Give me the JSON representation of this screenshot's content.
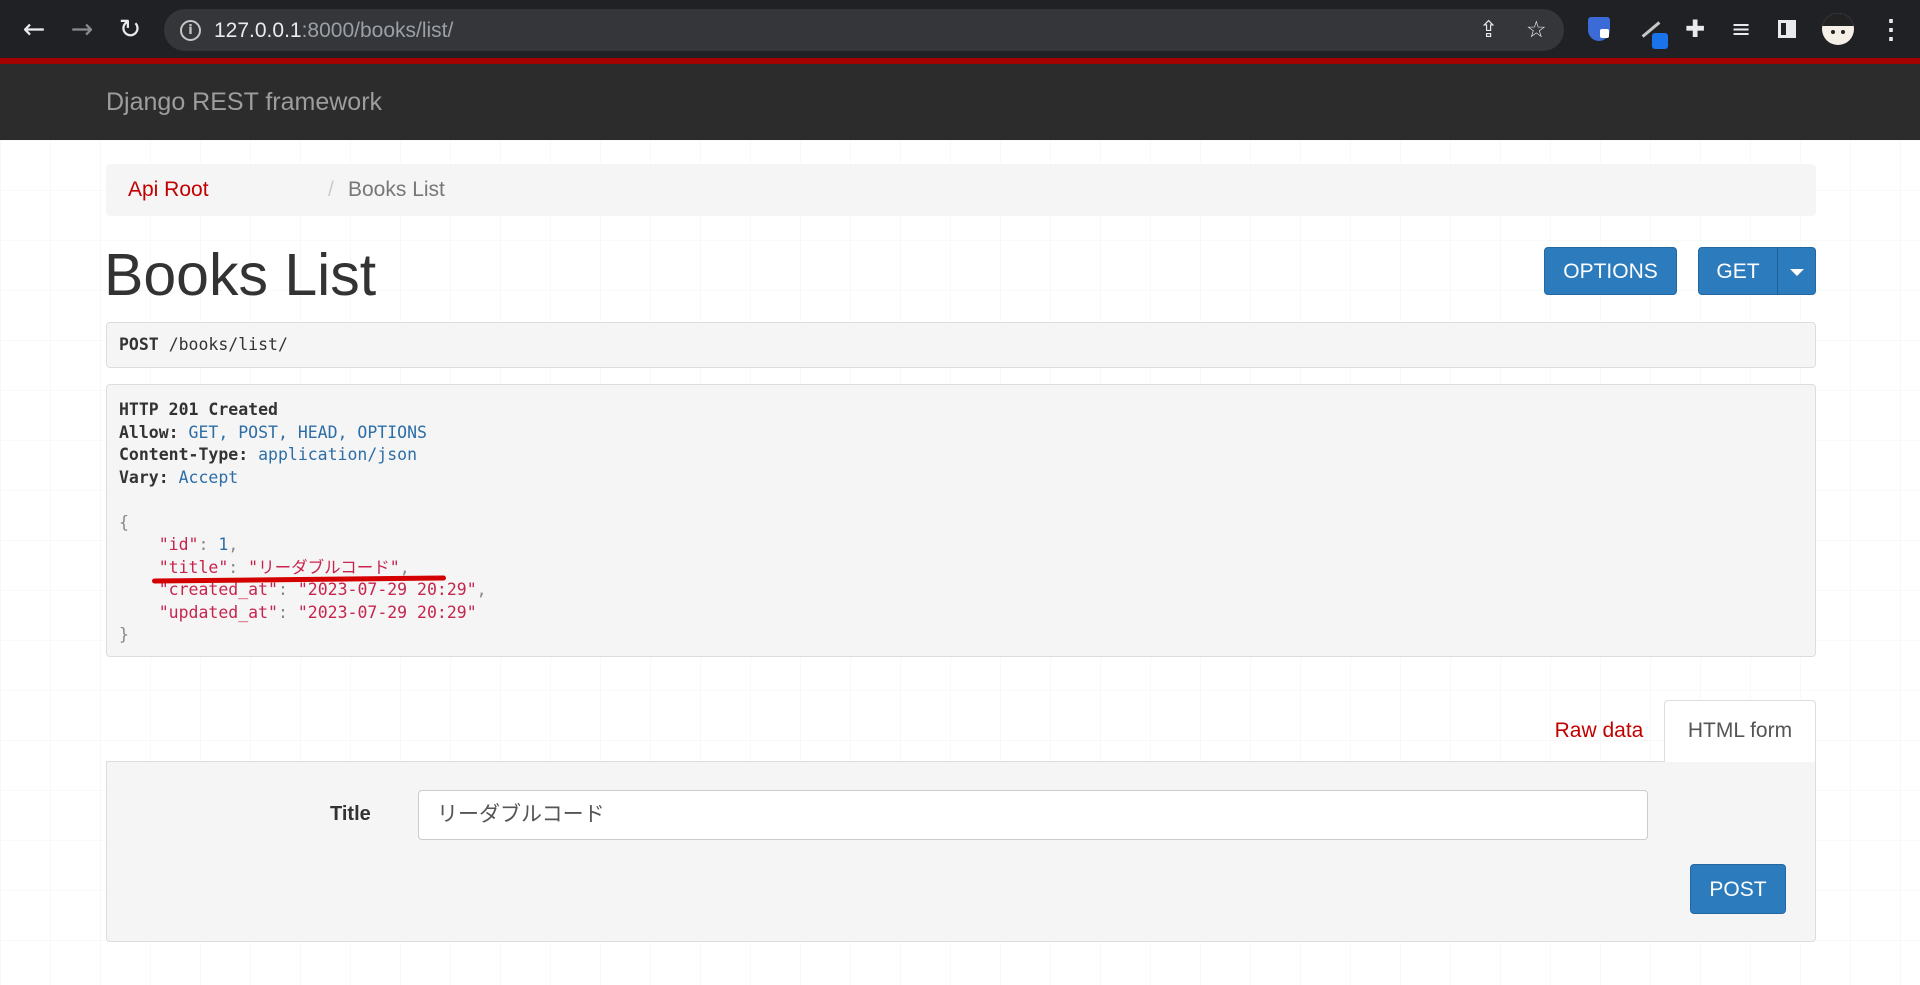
{
  "browser": {
    "url_host": "127.0.0.1",
    "url_rest": ":8000/books/list/"
  },
  "navbar": {
    "brand": "Django REST framework"
  },
  "breadcrumb": {
    "link": "Api Root",
    "separator": "/",
    "active": "Books List"
  },
  "page": {
    "title": "Books List"
  },
  "buttons": {
    "options": "OPTIONS",
    "get": "GET",
    "post": "POST"
  },
  "request": {
    "method": "POST",
    "path": "/books/list/"
  },
  "response": {
    "status": "HTTP 201 Created",
    "headers": [
      {
        "key": "Allow:",
        "value": "GET, POST, HEAD, OPTIONS"
      },
      {
        "key": "Content-Type:",
        "value": "application/json"
      },
      {
        "key": "Vary:",
        "value": "Accept"
      }
    ],
    "body": {
      "open": "{",
      "close": "}",
      "fields": [
        {
          "key": "\"id\"",
          "value": "1",
          "type": "num",
          "comma": ","
        },
        {
          "key": "\"title\"",
          "value": "\"リーダブルコード\"",
          "type": "str",
          "comma": ","
        },
        {
          "key": "\"created_at\"",
          "value": "\"2023-07-29 20:29\"",
          "type": "str",
          "comma": ","
        },
        {
          "key": "\"updated_at\"",
          "value": "\"2023-07-29 20:29\"",
          "type": "str",
          "comma": ""
        }
      ]
    }
  },
  "tabs": {
    "raw": "Raw data",
    "html": "HTML form"
  },
  "form": {
    "title_label": "Title",
    "title_value": "リーダブルコード"
  },
  "colors": {
    "accent": "#c20000",
    "button": "#2c7bbd",
    "navbar": "#2c2c2c",
    "annotation": "#d40000"
  }
}
